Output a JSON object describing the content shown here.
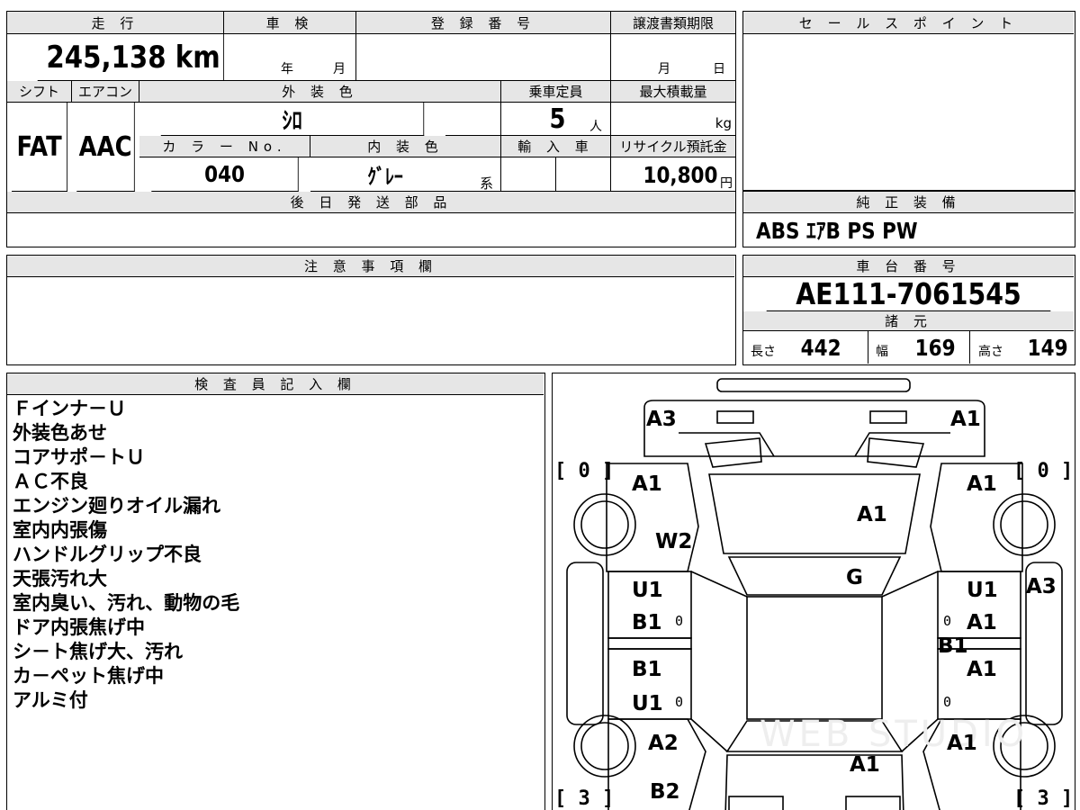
{
  "summary": {
    "mileage_header": "走 行",
    "mileage_value": "245,138 km",
    "inspection_header": "車 検",
    "inspection_year": "年",
    "inspection_month": "月",
    "registration_header": "登 録 番 号",
    "transfer_header": "譲渡書類期限",
    "transfer_month": "月",
    "transfer_day": "日",
    "shift_header": "シフト",
    "shift_value": "FAT",
    "ac_header": "エアコン",
    "ac_value": "AAC",
    "exterior_header": "外 装 色",
    "exterior_value": "ｼﾛ",
    "capacity_header": "乗車定員",
    "capacity_value": "5",
    "capacity_unit": "人",
    "maxload_header": "最大積載量",
    "maxload_unit": "kg",
    "color_no_header": "カ ラ ー No.",
    "color_no_value": "040",
    "interior_header": "内 装 色",
    "interior_value": "ｸﾞﾚｰ",
    "interior_suffix": "系",
    "import_header": "輸 入 車",
    "recycle_header": "リサイクル預託金",
    "recycle_value": "10,800",
    "recycle_unit": "円",
    "later_parts_header": "後 日 発 送 部 品"
  },
  "sales_point": {
    "header": "セ ー ル ス ポ イ ン ト"
  },
  "standard_equipment": {
    "header": "純 正 装 備",
    "value": "ABS ｴｱB PS PW"
  },
  "caution": {
    "header": "注 意 事 項 欄"
  },
  "chassis": {
    "header": "車 台 番 号",
    "value": "AE111-7061545",
    "specs_header": "諸 元",
    "length_label": "長さ",
    "length_value": "442",
    "width_label": "幅",
    "width_value": "169",
    "height_label": "高さ",
    "height_value": "149"
  },
  "inspector": {
    "header": "検 査 員 記 入 欄",
    "notes": [
      "Ｆインナ－Ｕ",
      "外装色あせ",
      "コアサポ－トＵ",
      "ＡＣ不良",
      "エンジン廻りオイル漏れ",
      "室内内張傷",
      "ハンドルグリップ不良",
      "天張汚れ大",
      "室内臭い、汚れ、動物の毛",
      "ドア内張焦げ中",
      "シ－ト焦げ大、汚れ",
      "カ－ペット焦げ中",
      "アルミ付"
    ]
  },
  "diagram": {
    "labels": {
      "front_left_corner": "A3",
      "front_right_corner": "A1",
      "left_fender": "A1",
      "right_fender": "A1",
      "hood": "A1",
      "left_windshield": "W2",
      "windshield": "G",
      "left_front_door_1": "U1",
      "left_front_door_2": "B1",
      "right_front_door_1": "U1",
      "right_front_door_2": "A1",
      "right_pillar": "B1",
      "right_side": "A3",
      "left_rear_door_1": "B1",
      "left_rear_door_2": "U1",
      "right_rear_door": "A1",
      "left_quarter": "A2",
      "right_quarter": "A1",
      "trunk": "A1",
      "rear_left": "B2"
    },
    "tires": {
      "front_left": "[ 0 ]",
      "front_right": "[ 0 ]",
      "rear_left": "[ 3 ]",
      "rear_right": "[ 3 ]"
    },
    "zero_marks": [
      "0",
      "0",
      "0",
      "0"
    ],
    "watermark": "WEB STUDIO"
  }
}
